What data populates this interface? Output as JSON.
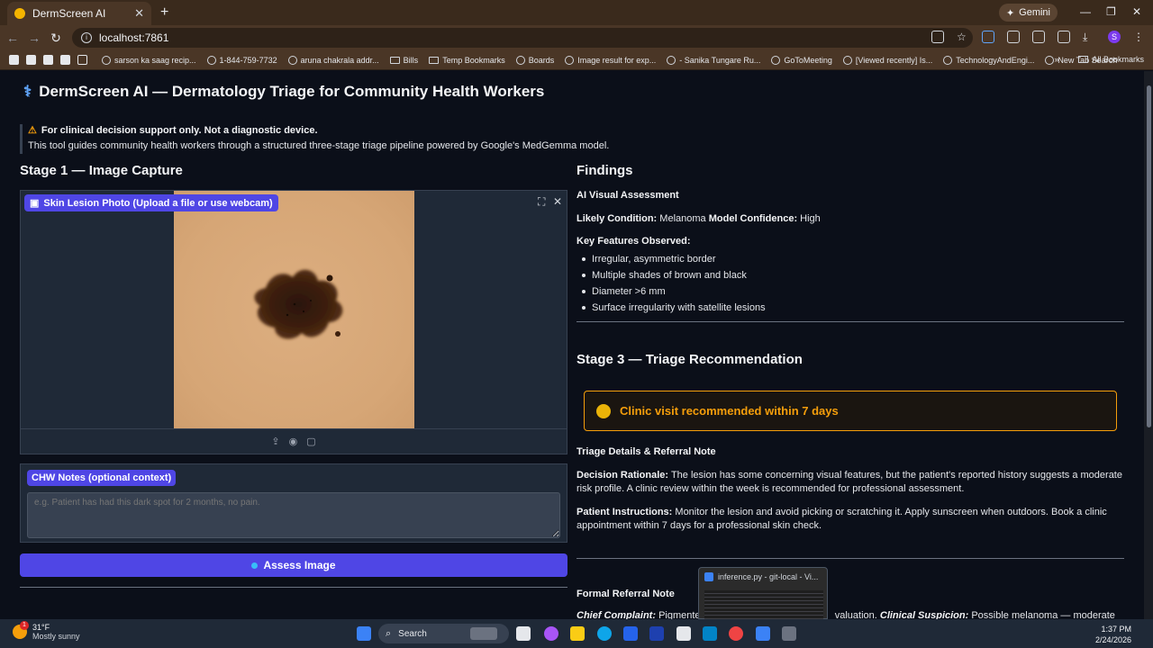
{
  "browser": {
    "tab_title": "DermScreen AI",
    "new_tab_glyph": "+",
    "gemini_label": "Gemini",
    "url": "localhost:7861",
    "bookmarks": [
      {
        "label": "sarson ka saag recip...",
        "icon": "globe-icon"
      },
      {
        "label": "1-844-759-7732",
        "icon": "globe-icon"
      },
      {
        "label": "aruna chakrala addr...",
        "icon": "globe-icon"
      },
      {
        "label": "Bills",
        "icon": "folder-icon"
      },
      {
        "label": "Temp Bookmarks",
        "icon": "folder-icon"
      },
      {
        "label": "Boards",
        "icon": "globe-icon"
      },
      {
        "label": "Image result for exp...",
        "icon": "globe-icon"
      },
      {
        "label": "- Sanika Tungare Ru...",
        "icon": "globe-icon"
      },
      {
        "label": "GoToMeeting",
        "icon": "globe-icon"
      },
      {
        "label": "[Viewed recently] Is...",
        "icon": "globe-icon"
      },
      {
        "label": "TechnologyAndEngi...",
        "icon": "globe-icon"
      },
      {
        "label": "New Tab Search",
        "icon": "globe-icon"
      }
    ],
    "all_bookmarks": "All Bookmarks",
    "profile_initial": "S"
  },
  "app": {
    "title": "DermScreen AI — Dermatology Triage for Community Health Workers",
    "disclaimer": "For clinical decision support only. Not a diagnostic device.",
    "description": "This tool guides community health workers through a structured three-stage triage pipeline powered by Google's MedGemma model."
  },
  "stage1": {
    "heading": "Stage 1 — Image Capture",
    "image_label": "Skin Lesion Photo (Upload a file or use webcam)",
    "notes_label": "CHW Notes (optional context)",
    "notes_placeholder": "e.g. Patient has had this dark spot for 2 months, no pain.",
    "assess_button": "Assess Image"
  },
  "findings": {
    "heading": "Findings",
    "subheading": "AI Visual Assessment",
    "likely_condition_label": "Likely Condition:",
    "likely_condition": "Melanoma",
    "confidence_label": "Model Confidence:",
    "confidence": "High",
    "key_features_label": "Key Features Observed:",
    "key_features": [
      "Irregular, asymmetric border",
      "Multiple shades of brown and black",
      "Diameter >6 mm",
      "Surface irregularity with satellite lesions"
    ]
  },
  "stage3": {
    "heading": "Stage 3 — Triage Recommendation",
    "triage": "Clinic visit recommended within 7 days",
    "triage_color": "#f59e0b",
    "details_heading": "Triage Details & Referral Note",
    "rationale_label": "Decision Rationale:",
    "rationale": "The lesion has some concerning visual features, but the patient's reported history suggests a moderate risk profile. A clinic review within the week is recommended for professional assessment.",
    "instructions_label": "Patient Instructions:",
    "instructions": "Monitor the lesion and avoid picking or scratching it. Apply sunscreen when outdoors. Book a clinic appointment within 7 days for a professional skin check.",
    "referral_heading": "Formal Referral Note",
    "complaint_label": "Chief Complaint:",
    "complaint": "Pigmented",
    "complaint_tail": "valuation.",
    "suspicion_label": "Clinical Suspicion:",
    "suspicion": "Possible melanoma — moderate"
  },
  "taskbar": {
    "temperature": "31°F",
    "weather": "Mostly sunny",
    "weather_badge": "1",
    "search": "Search",
    "time": "1:37 PM",
    "date": "2/24/2026",
    "preview_title": "inference.py - git-local - Vi..."
  }
}
